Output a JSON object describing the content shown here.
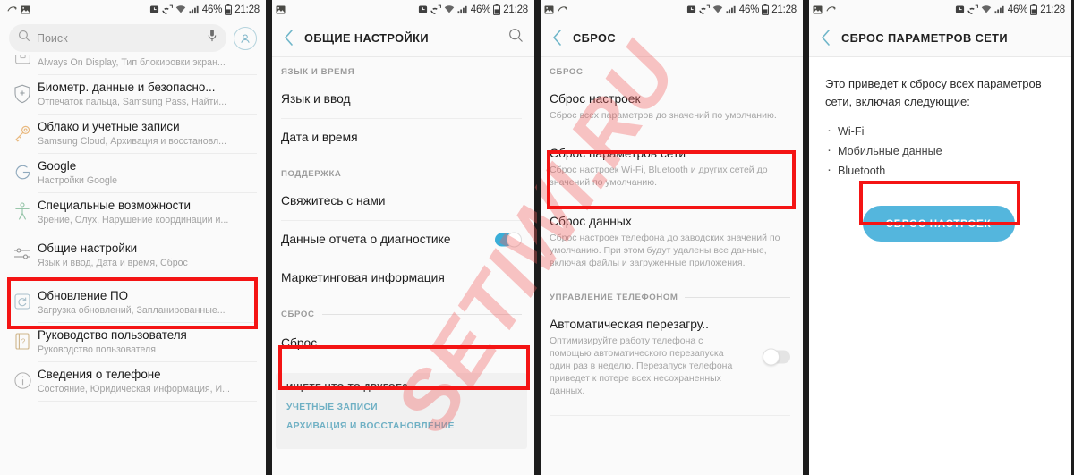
{
  "status_bar": {
    "battery": "46%",
    "time": "21:28",
    "icons": [
      "image-icon",
      "sync-icon",
      "alarm-icon",
      "missed-call-icon",
      "wifi-icon",
      "signal-icon",
      "battery-icon"
    ]
  },
  "watermark": {
    "text": "SETIWI.RU",
    "color": "#f25d5d"
  },
  "highlight_color": "#f41414",
  "accent_color": "#54b6dd",
  "panel1": {
    "search": {
      "placeholder": "Поиск",
      "mic_icon": "microphone-icon",
      "avatar_icon": "account-avatar-icon"
    },
    "items": [
      {
        "title": "",
        "sub": "Always On Display, Тип блокировки экран...",
        "icon": "lockscreen-icon",
        "clipped_top": true
      },
      {
        "title": "Биометр. данные и безопасно...",
        "sub": "Отпечаток пальца, Samsung Pass, Найти...",
        "icon": "shield-icon"
      },
      {
        "title": "Облако и учетные записи",
        "sub": "Samsung Cloud, Архивация и восстановл...",
        "icon": "key-icon"
      },
      {
        "title": "Google",
        "sub": "Настройки Google",
        "icon": "google-icon"
      },
      {
        "title": "Специальные возможности",
        "sub": "Зрение, Слух, Нарушение координации и...",
        "icon": "accessibility-icon"
      },
      {
        "title": "Общие настройки",
        "sub": "Язык и ввод, Дата и время, Сброс",
        "icon": "sliders-icon",
        "highlighted": true
      },
      {
        "title": "Обновление ПО",
        "sub": "Загрузка обновлений, Запланированные...",
        "icon": "software-update-icon"
      },
      {
        "title": "Руководство пользователя",
        "sub": "Руководство пользователя",
        "icon": "user-manual-icon"
      },
      {
        "title": "Сведения о телефоне",
        "sub": "Состояние, Юридическая информация, И...",
        "icon": "info-icon"
      }
    ]
  },
  "panel2": {
    "title": "ОБЩИЕ НАСТРОЙКИ",
    "back_icon": "back-chevron-icon",
    "search_icon": "search-icon",
    "sections": [
      {
        "label": "ЯЗЫК И ВРЕМЯ",
        "items": [
          {
            "title": "Язык и ввод"
          },
          {
            "title": "Дата и время"
          }
        ]
      },
      {
        "label": "ПОДДЕРЖКА",
        "items": [
          {
            "title": "Свяжитесь с нами"
          },
          {
            "title": "Данные отчета о диагностике",
            "toggle": "on"
          },
          {
            "title": "Маркетинговая информация"
          }
        ]
      },
      {
        "label": "СБРОС",
        "items": [
          {
            "title": "Сброс",
            "highlighted": true
          }
        ]
      }
    ],
    "footer_card": {
      "heading": "ИЩЕТЕ ЧТО-ТО ДРУГОЕ?",
      "links": [
        "УЧЕТНЫЕ ЗАПИСИ",
        "АРХИВАЦИЯ И ВОССТАНОВЛЕНИЕ"
      ]
    }
  },
  "panel3": {
    "title": "СБРОС",
    "back_icon": "back-chevron-icon",
    "sections": [
      {
        "label": "СБРОС",
        "items": [
          {
            "title": "Сброс настроек",
            "sub": "Сброс всех параметров до значений по умолчанию."
          },
          {
            "title": "Сброс параметров сети",
            "sub": "Сброс настроек Wi-Fi, Bluetooth и других сетей до значений по умолчанию.",
            "highlighted": true
          },
          {
            "title": "Сброс данных",
            "sub": "Сброс настроек телефона до заводских значений по умолчанию. При этом будут удалены все данные, включая файлы и загруженные приложения."
          }
        ]
      },
      {
        "label": "УПРАВЛЕНИЕ ТЕЛЕФОНОМ",
        "items": [
          {
            "title": "Автоматическая перезагру..",
            "sub": "Оптимизируйте работу телефона с помощью автоматического перезапуска один раз в неделю. Перезапуск телефона приведет к потере всех несохраненных данных.",
            "toggle": "off"
          }
        ]
      }
    ]
  },
  "panel4": {
    "title": "СБРОС ПАРАМЕТРОВ СЕТИ",
    "back_icon": "back-chevron-icon",
    "lead": "Это приведет к сбросу всех параметров сети, включая следующие:",
    "bullets": [
      "Wi-Fi",
      "Мобильные данные",
      "Bluetooth"
    ],
    "button_label": "СБРОС НАСТРОЕК"
  }
}
